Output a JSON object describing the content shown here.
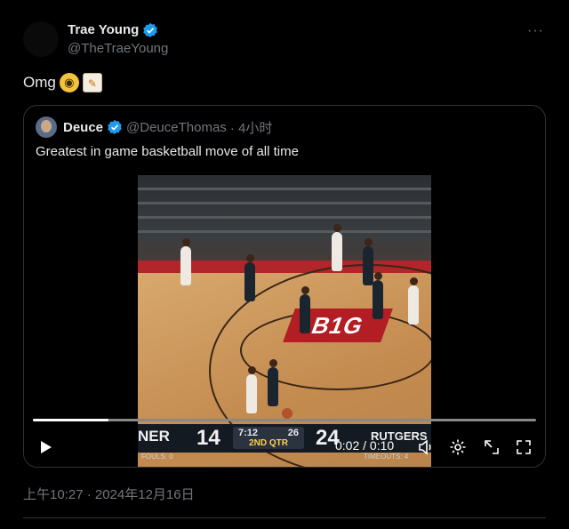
{
  "tweet": {
    "author_name": "Trae Young",
    "author_handle": "@TheTraeYoung",
    "text": "Omg",
    "emojis": [
      "face-screaming-in-fear",
      "memo"
    ],
    "timestamp": "上午10:27 · 2024年12月16日",
    "more_label": "···"
  },
  "quoted": {
    "author_name": "Deuce",
    "author_handle": "@DeuceThomas",
    "time_ago": "· 4小时",
    "text": "Greatest in game basketball move of all time"
  },
  "video": {
    "current_time": "0:02",
    "separator": " / ",
    "duration": "0:10",
    "progress": 0.15,
    "scoreboard": {
      "home_name": "NER",
      "home_score": "14",
      "clock": "7:12",
      "shot_clock": "26",
      "period": "2ND QTR",
      "away_score": "24",
      "away_name": "RUTGERS",
      "fouls_label": "FOULS: 0",
      "timeouts_label": "TIMEOUTS: 4"
    },
    "court_logo": "B1G"
  },
  "colors": {
    "background": "#000000",
    "text_primary": "#e7e9ea",
    "text_secondary": "#71767b",
    "border": "#2f3336",
    "verified": "#1d9bf0"
  }
}
